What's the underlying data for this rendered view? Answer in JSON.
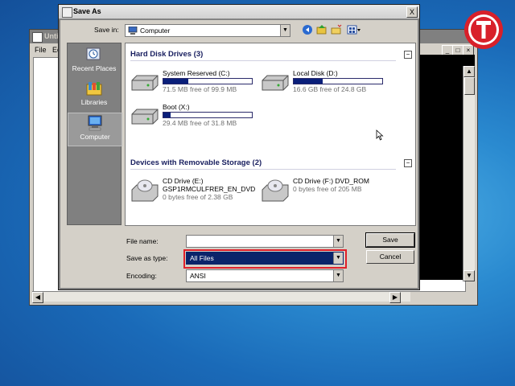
{
  "bg_window": {
    "title": "Unti",
    "menu": [
      "File",
      "Ec"
    ]
  },
  "dialog": {
    "title": "Save As",
    "close_label": "X",
    "save_in_label": "Save in:",
    "save_in_value": "Computer",
    "places": [
      {
        "label": "Recent Places",
        "icon": "recent-places-icon"
      },
      {
        "label": "Libraries",
        "icon": "libraries-icon"
      },
      {
        "label": "Computer",
        "icon": "computer-icon"
      }
    ],
    "groups": {
      "hdd": "Hard Disk Drives (3)",
      "removable": "Devices with Removable Storage (2)"
    },
    "drives": [
      {
        "name": "System Reserved (C:)",
        "detail": "71.5 MB free of 99.9 MB",
        "used": 0.28
      },
      {
        "name": "Local Disk (D:)",
        "detail": "16.6 GB free of 24.8 GB",
        "used": 0.33
      },
      {
        "name": "Boot (X:)",
        "detail": "29.4 MB free of 31.8 MB",
        "used": 0.08
      }
    ],
    "removable": [
      {
        "name": "CD Drive (E:)",
        "label": "GSP1RMCULFRER_EN_DVD",
        "detail": "0 bytes free of 2.38 GB"
      },
      {
        "name": "CD Drive (F:) DVD_ROM",
        "label": "",
        "detail": "0 bytes free of 205 MB"
      }
    ],
    "file_name_label": "File name:",
    "file_name_value": "",
    "save_as_type_label": "Save as type:",
    "save_as_type_value": "All Files",
    "encoding_label": "Encoding:",
    "encoding_value": "ANSI",
    "save_button": "Save",
    "cancel_button": "Cancel"
  },
  "colors": {
    "highlight_border": "#e0202a",
    "selection": "#0a246a",
    "logo_red": "#d8202a"
  }
}
